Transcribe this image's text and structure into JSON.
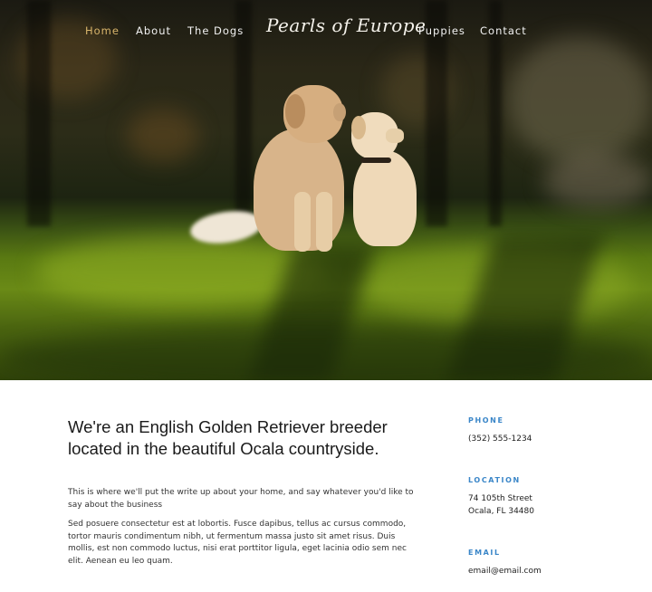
{
  "nav": {
    "items": [
      {
        "label": "Home",
        "active": true
      },
      {
        "label": "About",
        "active": false
      },
      {
        "label": "The Dogs",
        "active": false
      },
      {
        "label": "Puppies",
        "active": false
      },
      {
        "label": "Contact",
        "active": false
      }
    ],
    "logo": "Pearls of Europe"
  },
  "main": {
    "headline": "We're an English Golden Retriever breeder located in the beautiful Ocala countryside.",
    "paragraph1": "This is where we'll put the write up about your home, and say whatever you'd like to say about the business",
    "paragraph2": "Sed posuere consectetur est at lobortis. Fusce dapibus, tellus ac cursus commodo, tortor mauris condimentum nibh, ut fermentum massa justo sit amet risus. Duis mollis, est non commodo luctus, nisi erat porttitor ligula, eget lacinia odio sem nec elit. Aenean eu leo quam."
  },
  "contact": {
    "phone_label": "PHONE",
    "phone": "(352) 555-1234",
    "location_label": "LOCATION",
    "address_line1": "74 105th Street",
    "address_line2": "Ocala, FL 34480",
    "email_label": "EMAIL",
    "email": "email@email.com"
  },
  "colors": {
    "accent_link": "#3a86c8",
    "active_nav": "#d9b56b"
  }
}
